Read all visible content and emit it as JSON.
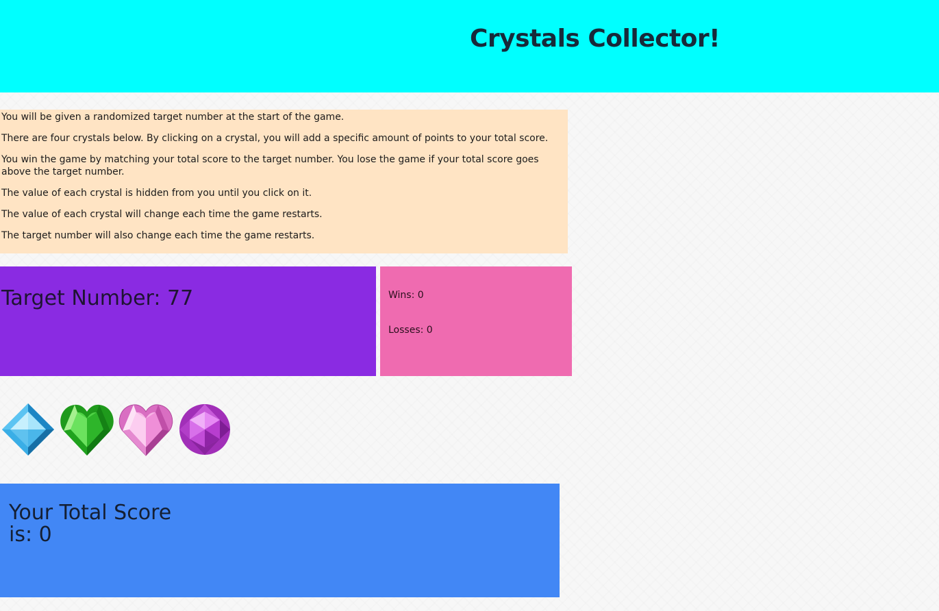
{
  "header": {
    "title": "Crystals Collector!"
  },
  "instructions": [
    "You will be given a randomized target number at the start of the game.",
    "There are four crystals below. By clicking on a crystal, you will add a specific amount of points to your total score.",
    "You win the game by matching your total score to the target number. You lose the game if your total score goes above the target number.",
    "The value of each crystal is hidden from you until you click on it.",
    "The value of each crystal will change each time the game restarts.",
    "The target number will also change each time the game restarts."
  ],
  "target": {
    "label": "Target Number: 77"
  },
  "record": {
    "wins": "Wins: 0",
    "losses": "Losses: 0"
  },
  "crystals": [
    {
      "icon": "blue-square-crystal-icon",
      "color": "#3fb4ea"
    },
    {
      "icon": "green-heart-crystal-icon",
      "color": "#2db82a"
    },
    {
      "icon": "pink-heart-crystal-icon",
      "color": "#f08ad6"
    },
    {
      "icon": "purple-round-crystal-icon",
      "color": "#b23cc9"
    }
  ],
  "score": {
    "label": "Your Total Score is: 0"
  },
  "colors": {
    "header": "#00ffff",
    "instructions": "#ffe4c4",
    "target": "#8a2be2",
    "record": "#ef6bb0",
    "score": "#4287f5"
  }
}
